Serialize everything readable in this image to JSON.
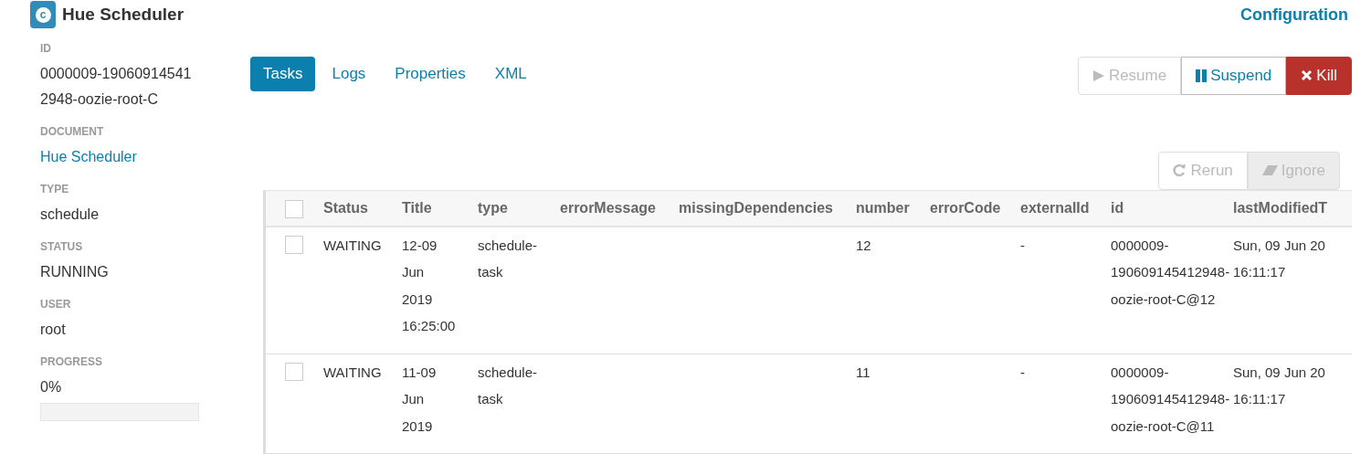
{
  "header": {
    "logo_letter": "c",
    "title": "Hue Scheduler",
    "configuration_link": "Configuration"
  },
  "sidebar": [
    {
      "label": "ID",
      "value": "0000009-190609145412948-oozie-root-C",
      "kind": "text"
    },
    {
      "label": "DOCUMENT",
      "value": "Hue Scheduler",
      "kind": "link"
    },
    {
      "label": "TYPE",
      "value": "schedule",
      "kind": "text"
    },
    {
      "label": "STATUS",
      "value": "RUNNING",
      "kind": "text"
    },
    {
      "label": "USER",
      "value": "root",
      "kind": "text"
    },
    {
      "label": "PROGRESS",
      "value": "0%",
      "kind": "progress",
      "level": 0
    }
  ],
  "tabs": [
    {
      "label": "Tasks",
      "selected": true
    },
    {
      "label": "Logs",
      "selected": false
    },
    {
      "label": "Properties",
      "selected": false
    },
    {
      "label": "XML",
      "selected": false
    }
  ],
  "actions": [
    {
      "label": "Resume",
      "kind": "resume",
      "disabled": true
    },
    {
      "label": "Suspend",
      "kind": "suspend",
      "disabled": false
    },
    {
      "label": "Kill",
      "kind": "kill",
      "disabled": false
    }
  ],
  "table_actions": [
    {
      "label": "Rerun",
      "kind": "rerun",
      "disabled": true
    },
    {
      "label": "Ignore",
      "kind": "ignore",
      "disabled": true
    }
  ],
  "table": {
    "select_all_checked": false,
    "columns": [
      "Status",
      "Title",
      "type",
      "errorMessage",
      "missingDependencies",
      "number",
      "errorCode",
      "externalId",
      "id",
      "lastModifiedT"
    ],
    "rows": [
      {
        "checked": false,
        "cells": [
          "WAITING",
          "12-09 Jun 2019 16:25:00",
          "schedule-task",
          "",
          "",
          "12",
          "",
          "-",
          "0000009-190609145412948-oozie-root-C@12",
          "Sun, 09 Jun 20\n16:11:17"
        ]
      },
      {
        "checked": false,
        "cells": [
          "WAITING",
          "11-09 Jun 2019",
          "schedule-task",
          "",
          "",
          "11",
          "",
          "-",
          "0000009-190609145412948-oozie-root-C@11",
          "Sun, 09 Jun 20\n16:11:17"
        ]
      }
    ]
  }
}
